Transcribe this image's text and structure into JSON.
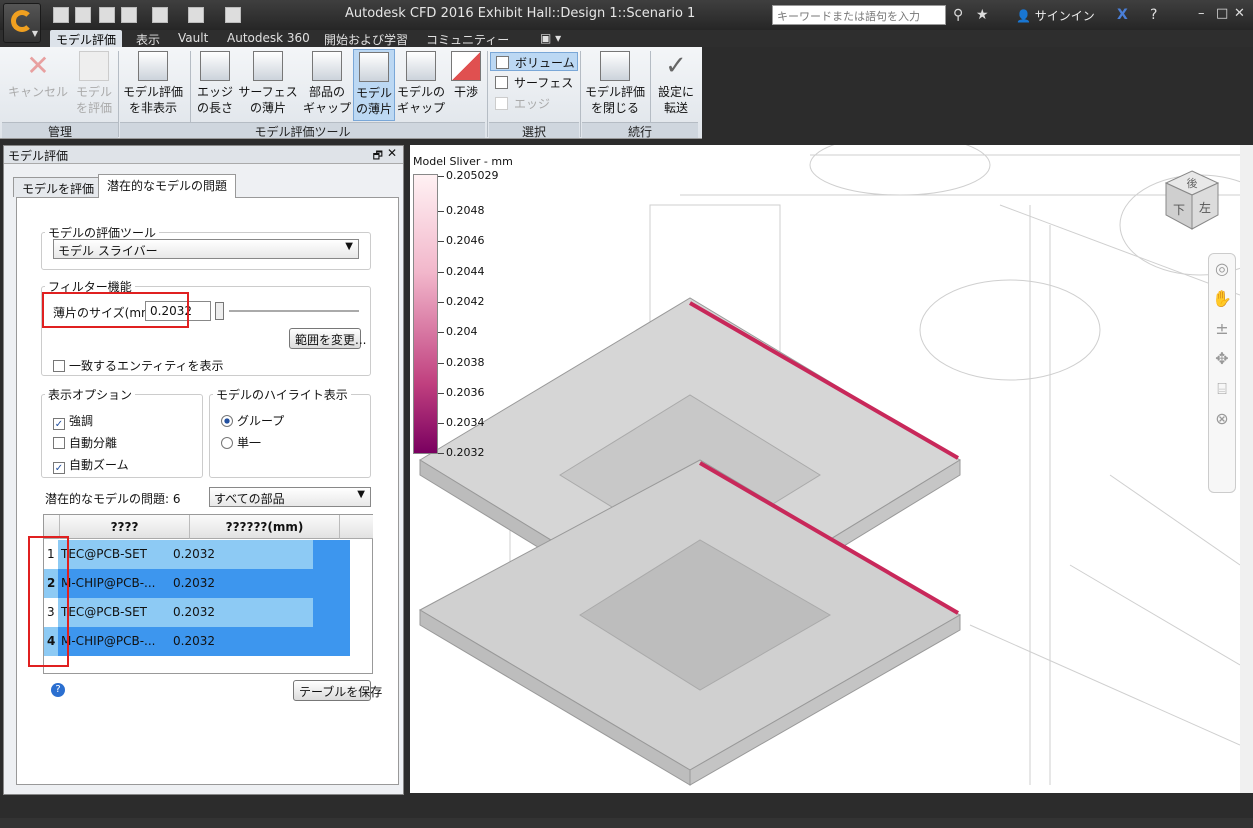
{
  "window": {
    "title": "Autodesk CFD 2016   Exhibit Hall::Design 1::Scenario 1",
    "search_placeholder": "キーワードまたは語句を入力",
    "signin": "サインイン"
  },
  "tabs": [
    "モデル評価",
    "表示",
    "Vault",
    "Autodesk 360",
    "開始および学習",
    "コミュニティー"
  ],
  "ribbon": {
    "cancel": "キャンセル",
    "evaluate_1": "モデル",
    "evaluate_2": "を評価",
    "hide_1": "モデル評価",
    "hide_2": "を非表示",
    "edge_1": "エッジ",
    "edge_2": "の長さ",
    "surface_1": "サーフェス",
    "surface_2": "の薄片",
    "part_gap_1": "部品の",
    "part_gap_2": "ギャップ",
    "model_sliver_1": "モデル",
    "model_sliver_2": "の薄片",
    "model_gap_1": "モデルの",
    "model_gap_2": "ギャップ",
    "interference": "干渉",
    "sel_volume": "ボリューム",
    "sel_surface": "サーフェス",
    "sel_edge": "エッジ",
    "close_1": "モデル評価",
    "close_2": "を閉じる",
    "transfer_1": "設定に",
    "transfer_2": "転送",
    "group_manage": "管理",
    "group_tools": "モデル評価ツール",
    "group_select": "選択",
    "group_continue": "続行"
  },
  "panel": {
    "title": "モデル評価",
    "tab1": "モデルを評価",
    "tab2": "潜在的なモデルの問題",
    "tool_legend": "モデルの評価ツール",
    "tool_value": "モデル スライバー",
    "filter_legend": "フィルター機能",
    "sliver_label": "薄片のサイズ(mm)",
    "sliver_value": "0.2032",
    "range_button": "範囲を変更...",
    "show_matching": "一致するエンティティを表示",
    "display_legend": "表示オプション",
    "opt_highlight": "強調",
    "opt_autoisolate": "自動分離",
    "opt_autozoom": "自動ズーム",
    "highlight_legend": "モデルのハイライト表示",
    "hl_group": "グループ",
    "hl_single": "単一",
    "issues_label": "潜在的なモデルの問題: 6",
    "parts_filter": "すべての部品",
    "col1": "????",
    "col2": "??????(mm)",
    "rows": [
      {
        "n": "1",
        "name": "TEC@PCB-SET",
        "value": "0.2032"
      },
      {
        "n": "2",
        "name": "M-CHIP@PCB-...",
        "value": "0.2032"
      },
      {
        "n": "3",
        "name": "TEC@PCB-SET",
        "value": "0.2032"
      },
      {
        "n": "4",
        "name": "M-CHIP@PCB-...",
        "value": "0.2032"
      }
    ],
    "save_table": "テーブルを保存"
  },
  "legend": {
    "title": "Model Sliver - mm",
    "ticks": [
      "0.205029",
      "0.2048",
      "0.2046",
      "0.2044",
      "0.2042",
      "0.204",
      "0.2038",
      "0.2036",
      "0.2034",
      "0.2032"
    ]
  },
  "viewcube": {
    "top": "後",
    "front": "下",
    "right": "左"
  },
  "colors": {
    "accent": "#3d96ee",
    "highlight_red": "#e02020",
    "sliver_edge": "#c8285a"
  }
}
